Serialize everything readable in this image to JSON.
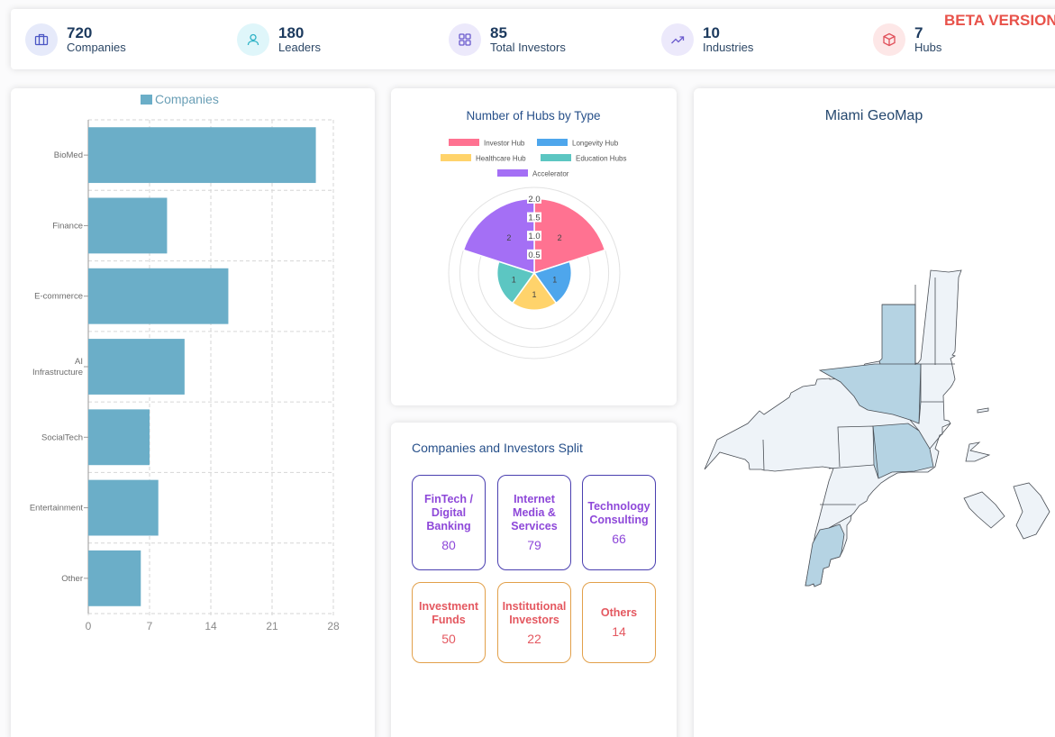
{
  "stats": [
    {
      "value": "720",
      "label": "Companies",
      "icon": "briefcase-icon",
      "bg": "#e6eafa",
      "fg": "#4b56c4"
    },
    {
      "value": "180",
      "label": "Leaders",
      "icon": "user-icon",
      "bg": "#dff6fa",
      "fg": "#2fb3c6"
    },
    {
      "value": "85",
      "label": "Total Investors",
      "icon": "grid-icon",
      "bg": "#ece9fb",
      "fg": "#6a5acd"
    },
    {
      "value": "10",
      "label": "Industries",
      "icon": "trending-up-icon",
      "bg": "#ece9fb",
      "fg": "#6a5acd"
    },
    {
      "value": "7",
      "label": "Hubs",
      "icon": "box-icon",
      "bg": "#fde7e7",
      "fg": "#e0505a"
    }
  ],
  "beta_label": "BETA VERSION",
  "chart_data": [
    {
      "type": "bar",
      "orientation": "horizontal",
      "legend": "Companies",
      "categories": [
        "BioMed",
        "Finance",
        "E-commerce",
        "AI Infrastructure",
        "SocialTech",
        "Entertainment",
        "Other"
      ],
      "category_lines": [
        [
          "BioMed"
        ],
        [
          "Finance"
        ],
        [
          "E-commerce"
        ],
        [
          "AI",
          "Infrastructure"
        ],
        [
          "SocialTech"
        ],
        [
          "Entertainment"
        ],
        [
          "Other"
        ]
      ],
      "values": [
        26,
        9,
        16,
        11,
        7,
        8,
        6
      ],
      "xticks": [
        "0",
        "7",
        "14",
        "21",
        "28"
      ],
      "xlim": [
        0,
        28
      ],
      "color": "#6baec8",
      "grid": true
    },
    {
      "type": "polar_area",
      "title": "Number of Hubs by Type",
      "categories": [
        "Investor Hub",
        "Longevity Hub",
        "Healthcare Hub",
        "Education Hubs",
        "Accelerator"
      ],
      "values": [
        2,
        1,
        1,
        1,
        2
      ],
      "colors": [
        "#ff7291",
        "#4ea6ec",
        "#ffd36b",
        "#5cc6c2",
        "#a46ff5"
      ],
      "rticks": [
        "0.5",
        "1.0",
        "1.5",
        "2.0"
      ],
      "rlim": [
        0,
        2.3
      ]
    }
  ],
  "split": {
    "title": "Companies and Investors Split",
    "companies": [
      {
        "name": "FinTech / Digital Banking",
        "count": "80"
      },
      {
        "name": "Internet Media & Services",
        "count": "79"
      },
      {
        "name": "Technology Consulting",
        "count": "66"
      }
    ],
    "investors": [
      {
        "name": "Investment Funds",
        "count": "50"
      },
      {
        "name": "Institutional Investors",
        "count": "22"
      },
      {
        "name": "Others",
        "count": "14"
      }
    ]
  },
  "map": {
    "title": "Miami GeoMap",
    "fill_light": "#eef3f8",
    "fill_dark": "#b5d3e3",
    "stroke": "#4a4f56"
  }
}
